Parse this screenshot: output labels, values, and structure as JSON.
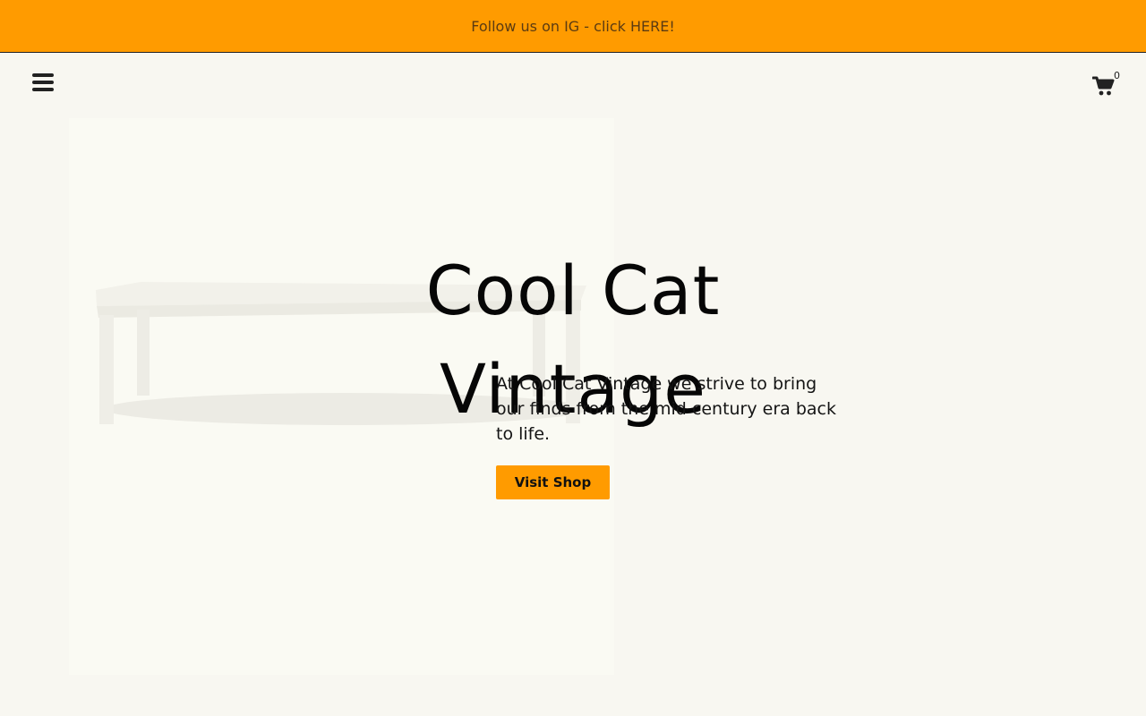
{
  "announcement": {
    "text": "Follow us on IG - click HERE!"
  },
  "header": {
    "menu_icon": "hamburger-menu-icon",
    "cart_icon": "shopping-cart-icon",
    "cart_count": "0"
  },
  "hero": {
    "title": "Cool Cat Vintage",
    "description": "At Cool Cat Vintage we strive to bring our finds from the mid century era back to life.",
    "button_label": "Visit Shop",
    "image_subject": "white-table-photo"
  },
  "colors": {
    "accent": "#ff9b00",
    "background": "#f8f7f1",
    "text": "#141414"
  }
}
